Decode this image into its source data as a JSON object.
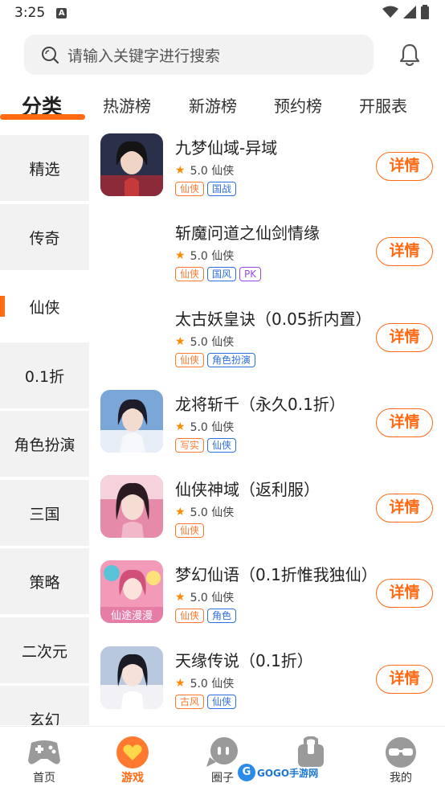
{
  "status_bar": {
    "time": "3:25"
  },
  "search": {
    "placeholder": "请输入关键字进行搜索"
  },
  "tabs": [
    {
      "label": "分类",
      "active": true
    },
    {
      "label": "热游榜"
    },
    {
      "label": "新游榜"
    },
    {
      "label": "预约榜"
    },
    {
      "label": "开服表"
    }
  ],
  "sidebar": {
    "items": [
      {
        "label": "精选"
      },
      {
        "label": "传奇"
      },
      {
        "label": "仙侠",
        "active": true
      },
      {
        "label": "0.1折"
      },
      {
        "label": "角色扮演"
      },
      {
        "label": "三国"
      },
      {
        "label": "策略"
      },
      {
        "label": "二次元"
      },
      {
        "label": "玄幻"
      }
    ]
  },
  "games": [
    {
      "title": "九梦仙域-异域",
      "rating": "5.0 仙侠",
      "tags": [
        {
          "text": "仙侠",
          "color": "orange"
        },
        {
          "text": "国战",
          "color": "blue"
        }
      ],
      "button": "详情",
      "icon": "portrait-dark-hair",
      "icon_colors": [
        "#2a2f4a",
        "#c43a3a"
      ]
    },
    {
      "title": "斩魔问道之仙剑情缘",
      "rating": "5.0 仙侠",
      "tags": [
        {
          "text": "仙侠",
          "color": "orange"
        },
        {
          "text": "国风",
          "color": "blue"
        },
        {
          "text": "PK",
          "color": "purple"
        }
      ],
      "button": "详情",
      "icon": "none"
    },
    {
      "title": "太古妖皇诀（0.05折内置）",
      "rating": "5.0 仙侠",
      "tags": [
        {
          "text": "仙侠",
          "color": "orange"
        },
        {
          "text": "角色扮演",
          "color": "blue"
        }
      ],
      "button": "详情",
      "icon": "none"
    },
    {
      "title": "龙将斩千（永久0.1折）",
      "rating": "5.0 仙侠",
      "tags": [
        {
          "text": "写实",
          "color": "orange"
        },
        {
          "text": "仙侠",
          "color": "blue"
        }
      ],
      "button": "详情",
      "icon": "portrait-blue-robe",
      "icon_colors": [
        "#7aa7d8",
        "#e8eef8"
      ]
    },
    {
      "title": "仙侠神域（返利服）",
      "rating": "5.0 仙侠",
      "tags": [
        {
          "text": "仙侠",
          "color": "orange"
        }
      ],
      "button": "详情",
      "icon": "portrait-pink",
      "icon_colors": [
        "#e58aa8",
        "#f6d2dc"
      ]
    },
    {
      "title": "梦幻仙语（0.1折惟我独仙）",
      "rating": "5.0 仙侠",
      "tags": [
        {
          "text": "仙侠",
          "color": "orange"
        },
        {
          "text": "角色",
          "color": "blue"
        }
      ],
      "button": "详情",
      "icon": "portrait-flowers",
      "icon_caption": "仙途漫漫",
      "icon_colors": [
        "#f29ab8",
        "#59c3d8"
      ]
    },
    {
      "title": "天缘传说（0.1折）",
      "rating": "5.0 仙侠",
      "tags": [
        {
          "text": "古风",
          "color": "orange"
        },
        {
          "text": "仙侠",
          "color": "blue"
        }
      ],
      "button": "详情",
      "icon": "portrait-white",
      "icon_colors": [
        "#b8c8de",
        "#f2f2f6"
      ]
    }
  ],
  "bottom_nav": [
    {
      "label": "首页",
      "icon": "gamepad-icon"
    },
    {
      "label": "游戏",
      "icon": "heart-chat-icon",
      "active": true
    },
    {
      "label": "圈子",
      "icon": "chat-bubble-icon"
    },
    {
      "label": "",
      "icon": "bag-icon"
    },
    {
      "label": "我的",
      "icon": "glasses-face-icon"
    }
  ],
  "watermark": {
    "badge": "G",
    "text": "GOGO手游网"
  },
  "colors": {
    "accent": "#ff6a13",
    "sidebar_bg": "#f2f2f2",
    "tag_orange": "#ff7a30",
    "tag_blue": "#2f6fe0",
    "tag_purple": "#9b4ce0"
  }
}
